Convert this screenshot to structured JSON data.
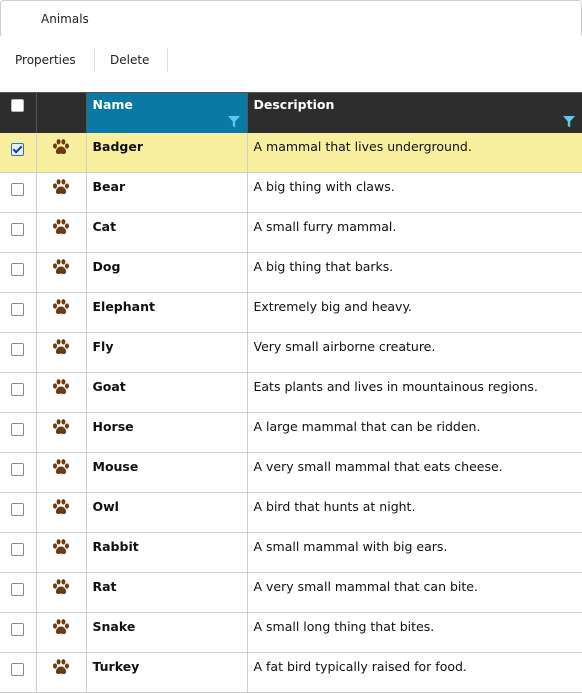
{
  "breadcrumb": {
    "title": "Animals"
  },
  "toolbar": {
    "properties_label": "Properties",
    "delete_label": "Delete"
  },
  "columns": {
    "name": "Name",
    "description": "Description"
  },
  "colors": {
    "header_bg": "#2d2d2d",
    "name_header_bg": "#0a79a6",
    "filter_icon": "#5ec8f0",
    "selected_row": "#f8ef9e",
    "paw": "#6b3a12"
  },
  "icons": {
    "row_icon": "paw-icon",
    "filter": "filter-icon"
  },
  "rows": [
    {
      "name": "Badger",
      "description": "A mammal that lives underground.",
      "checked": true
    },
    {
      "name": "Bear",
      "description": "A big thing with claws.",
      "checked": false
    },
    {
      "name": "Cat",
      "description": "A small furry mammal.",
      "checked": false
    },
    {
      "name": "Dog",
      "description": "A big thing that barks.",
      "checked": false
    },
    {
      "name": "Elephant",
      "description": "Extremely big and heavy.",
      "checked": false
    },
    {
      "name": "Fly",
      "description": "Very small airborne creature.",
      "checked": false
    },
    {
      "name": "Goat",
      "description": "Eats plants and lives in mountainous regions.",
      "checked": false
    },
    {
      "name": "Horse",
      "description": "A large mammal that can be ridden.",
      "checked": false
    },
    {
      "name": "Mouse",
      "description": "A very small mammal that eats cheese.",
      "checked": false
    },
    {
      "name": "Owl",
      "description": "A bird that hunts at night.",
      "checked": false
    },
    {
      "name": "Rabbit",
      "description": "A small mammal with big ears.",
      "checked": false
    },
    {
      "name": "Rat",
      "description": "A very small mammal that can bite.",
      "checked": false
    },
    {
      "name": "Snake",
      "description": "A small long thing that bites.",
      "checked": false
    },
    {
      "name": "Turkey",
      "description": "A fat bird typically raised for food.",
      "checked": false
    }
  ]
}
